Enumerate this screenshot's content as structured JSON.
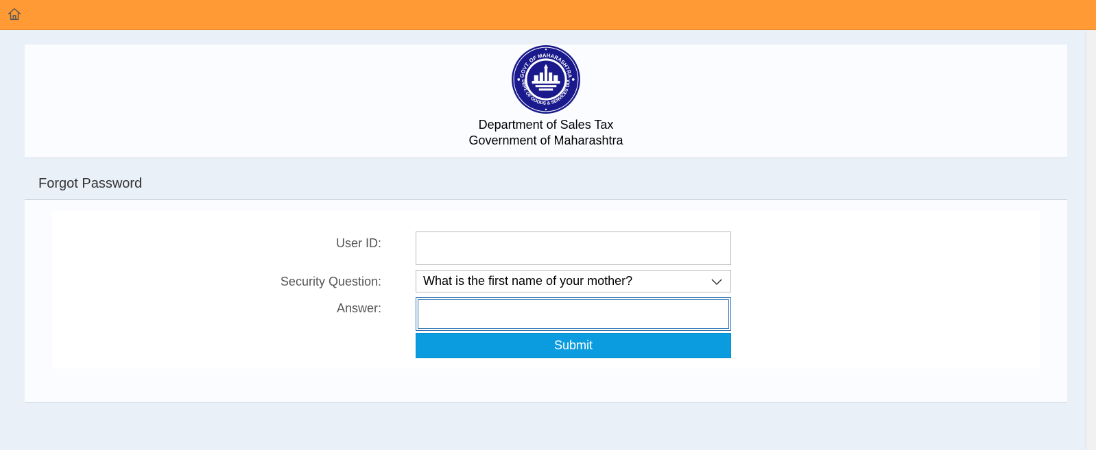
{
  "topbar": {
    "home_icon": "home-icon",
    "color": "#ff9a35"
  },
  "header": {
    "dept_name": "Department of Sales Tax",
    "gov_name": "Government of Maharashtra",
    "emblem_text": "GOVT. OF MAHARASHTRA · DEPT. OF GOODS & SERVICES TAX"
  },
  "section": {
    "title": "Forgot Password"
  },
  "form": {
    "user_id_label": "User ID:",
    "user_id_value": "",
    "security_question_label": "Security Question:",
    "security_question_value": "What is the first name of your mother?",
    "answer_label": "Answer:",
    "answer_value": "",
    "submit_label": "Submit"
  },
  "colors": {
    "accent": "#0b9ce0",
    "emblem": "#1a1a8c"
  }
}
